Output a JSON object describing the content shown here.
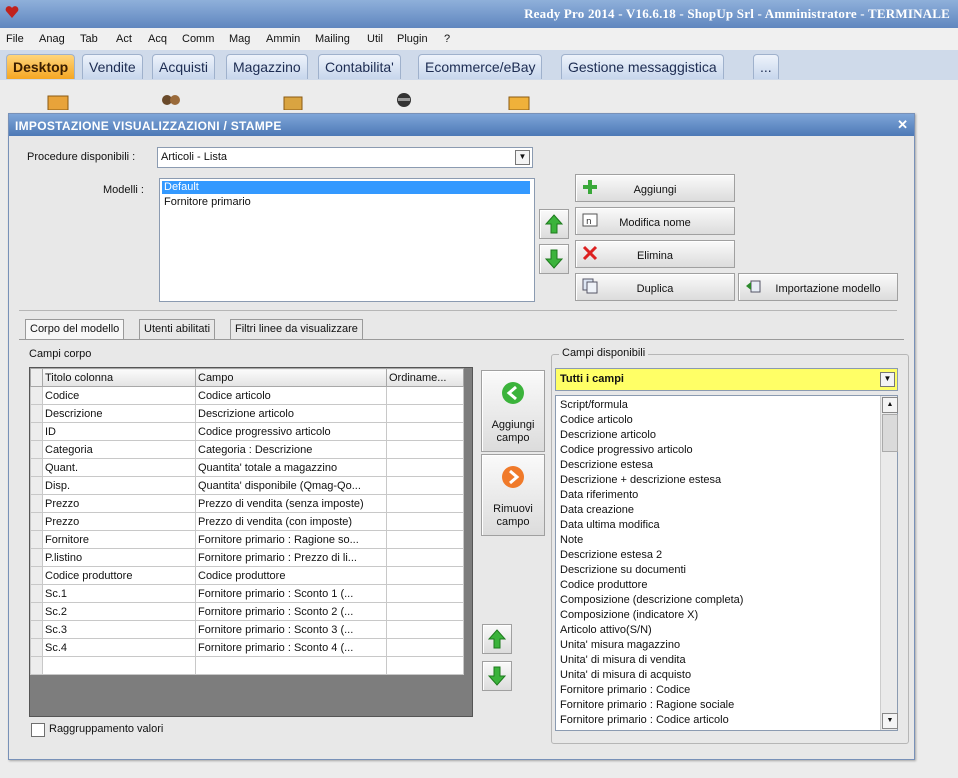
{
  "window": {
    "title": "Ready Pro 2014 - V16.6.18 - ShopUp Srl - Amministratore - TERMINALE"
  },
  "menu": [
    "File",
    "Anag",
    "Tab",
    "Act",
    "Acq",
    "Comm",
    "Mag",
    "Ammin",
    "Mailing",
    "Util",
    "Plugin",
    "?"
  ],
  "tabs": [
    "Desktop",
    "Vendite",
    "Acquisti",
    "Magazzino",
    "Contabilita'",
    "Ecommerce/eBay",
    "Gestione messaggistica",
    "..."
  ],
  "dialog": {
    "title": "IMPOSTAZIONE VISUALIZZAZIONI / STAMPE",
    "procedure_label": "Procedure disponibili :",
    "procedure_value": "Articoli - Lista",
    "models_label": "Modelli :",
    "models": [
      "Default",
      "Fornitore primario"
    ],
    "buttons": {
      "add": "Aggiungi",
      "rename": "Modifica nome",
      "delete": "Elimina",
      "duplicate": "Duplica",
      "import": "Importazione modello"
    },
    "subtabs": [
      "Corpo del modello",
      "Utenti abilitati",
      "Filtri linee da visualizzare"
    ],
    "fields_body_label": "Campi corpo",
    "grid": {
      "headers": [
        "Titolo colonna",
        "Campo",
        "Ordiname..."
      ],
      "rows": [
        [
          "Codice",
          "Codice articolo",
          ""
        ],
        [
          "Descrizione",
          "Descrizione articolo",
          ""
        ],
        [
          "ID",
          "Codice progressivo articolo",
          ""
        ],
        [
          "Categoria",
          "Categoria : Descrizione",
          ""
        ],
        [
          "Quant.",
          "Quantita' totale a magazzino",
          ""
        ],
        [
          "Disp.",
          "Quantita' disponibile (Qmag-Qo...",
          ""
        ],
        [
          "Prezzo",
          "Prezzo di vendita (senza imposte)",
          ""
        ],
        [
          "Prezzo",
          "Prezzo di vendita (con imposte)",
          ""
        ],
        [
          "Fornitore",
          "Fornitore primario : Ragione so...",
          ""
        ],
        [
          "P.listino",
          "Fornitore primario : Prezzo di li...",
          ""
        ],
        [
          "Codice produttore",
          "Codice produttore",
          ""
        ],
        [
          "Sc.1",
          "Fornitore primario : Sconto 1 (...",
          ""
        ],
        [
          "Sc.2",
          "Fornitore primario : Sconto 2 (...",
          ""
        ],
        [
          "Sc.3",
          "Fornitore primario : Sconto 3 (...",
          ""
        ],
        [
          "Sc.4",
          "Fornitore primario : Sconto 4 (...",
          ""
        ],
        [
          "",
          "",
          ""
        ]
      ]
    },
    "add_field": "Aggiungi campo",
    "remove_field": "Rimuovi campo",
    "available_label": "Campi disponibili",
    "available_filter": "Tutti i campi",
    "available_fields": [
      "Script/formula",
      "Codice articolo",
      "Descrizione articolo",
      "Codice progressivo articolo",
      "Descrizione estesa",
      "Descrizione + descrizione estesa",
      "Data riferimento",
      "Data creazione",
      "Data ultima modifica",
      "Note",
      "Descrizione estesa 2",
      "Descrizione su documenti",
      "Codice produttore",
      "Composizione (descrizione completa)",
      "Composizione (indicatore X)",
      "Articolo attivo(S/N)",
      "Unita' misura magazzino",
      "Unita' di misura di vendita",
      "Unita' di misura di acquisto",
      "Fornitore primario : Codice",
      "Fornitore primario : Ragione sociale",
      "Fornitore primario : Codice articolo"
    ],
    "group_values": "Raggruppamento valori"
  },
  "colors": {
    "accent_tab": "#f5a623",
    "title_bar": "#4d79b6",
    "filter_bg": "#ffff66",
    "selection": "#3399ff"
  }
}
